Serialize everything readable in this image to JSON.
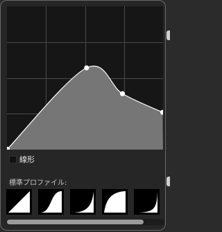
{
  "panel": {
    "linear_label": "線形",
    "linear_checked": false,
    "presets_label": "標準プロファイル:"
  },
  "curve": {
    "control_points": [
      {
        "x": 0.0,
        "y": 0.0
      },
      {
        "x": 0.51,
        "y": 0.57
      },
      {
        "x": 0.74,
        "y": 0.39
      },
      {
        "x": 1.0,
        "y": 0.26
      }
    ]
  },
  "presets": [
    {
      "name": "linear"
    },
    {
      "name": "s-curve"
    },
    {
      "name": "ease-in"
    },
    {
      "name": "ease-out"
    },
    {
      "name": "steep-ease-in"
    }
  ],
  "scroll": {
    "position": 0.0,
    "visible_fraction": 0.87
  },
  "colors": {
    "curve_fill": "#767676",
    "grid": "#4a4a4a",
    "curve_line": "#ffffff"
  }
}
